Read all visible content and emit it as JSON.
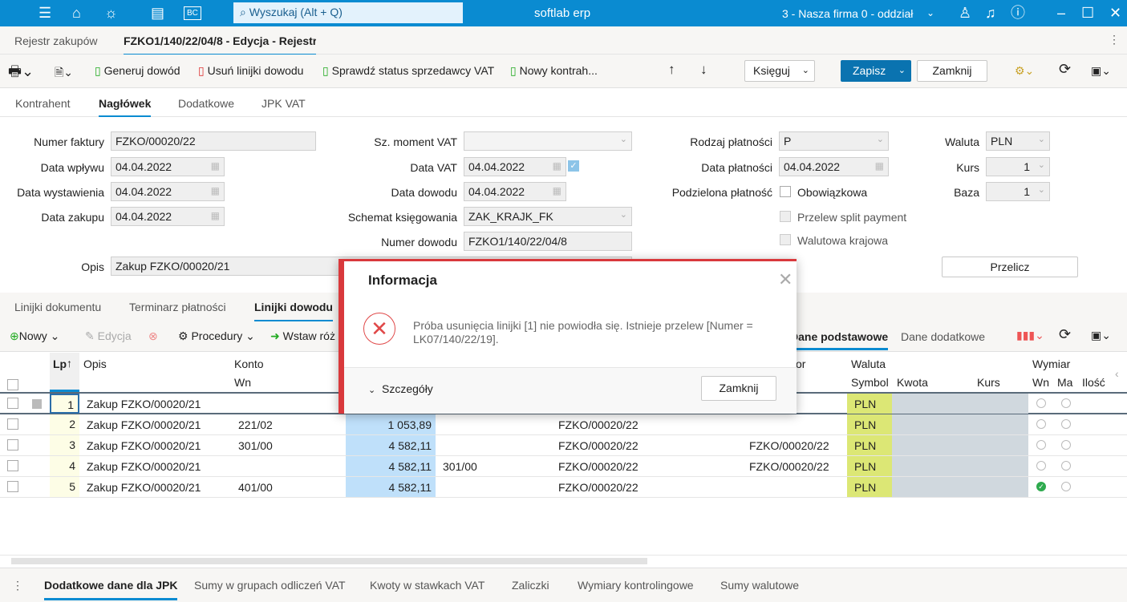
{
  "topbar": {
    "app_title": "softlab erp",
    "search_placeholder": "Wyszukaj (Alt + Q)",
    "company": "3 - Nasza firma 0 - oddział",
    "bc_label": "BC"
  },
  "tabs": [
    {
      "label": "Rejestr zakupów"
    },
    {
      "label": "FZKO1/140/22/04/8 - Edycja - Rejestr"
    }
  ],
  "toolbar": {
    "generate": "Generuj dowód",
    "delete_lines": "Usuń linijki dowodu",
    "check_vat": "Sprawdź status sprzedawcy VAT",
    "new_contractor": "Nowy kontrah...",
    "post": "Księguj",
    "save": "Zapisz",
    "close": "Zamknij"
  },
  "subtabs": [
    "Kontrahent",
    "Nagłówek",
    "Dodatkowe",
    "JPK VAT"
  ],
  "form": {
    "numer_faktury": {
      "label": "Numer faktury",
      "value": "FZKO/00020/22"
    },
    "data_wplywu": {
      "label": "Data wpływu",
      "value": "04.04.2022"
    },
    "data_wystawienia": {
      "label": "Data wystawienia",
      "value": "04.04.2022"
    },
    "data_zakupu": {
      "label": "Data zakupu",
      "value": "04.04.2022"
    },
    "opis": {
      "label": "Opis",
      "value": "Zakup FZKO/00020/21"
    },
    "sz_moment_vat": {
      "label": "Sz. moment VAT",
      "value": ""
    },
    "data_vat": {
      "label": "Data VAT",
      "value": "04.04.2022"
    },
    "data_dowodu": {
      "label": "Data dowodu",
      "value": "04.04.2022"
    },
    "schemat": {
      "label": "Schemat księgowania",
      "value": "ZAK_KRAJK_FK"
    },
    "numer_dowodu": {
      "label": "Numer dowodu",
      "value": "FZKO1/140/22/04/8"
    },
    "rodzaj_platnosci": {
      "label": "Rodzaj płatności",
      "value": "P"
    },
    "data_platnosci": {
      "label": "Data płatności",
      "value": "04.04.2022"
    },
    "podzielona": {
      "label": "Podzielona płatność",
      "option": "Obowiązkowa"
    },
    "split": "Przelew split payment",
    "walutowa": "Walutowa krajowa",
    "waluta": {
      "label": "Waluta",
      "value": "PLN"
    },
    "kurs": {
      "label": "Kurs",
      "value": "1"
    },
    "baza": {
      "label": "Baza",
      "value": "1"
    },
    "przelicz": "Przelicz"
  },
  "lower_tabs": [
    "Linijki dokumentu",
    "Terminarz płatności",
    "Linijki dowodu"
  ],
  "grid_toolbar": {
    "new": "Nowy",
    "edit": "Edycja",
    "procedures": "Procedury",
    "insert": "Wstaw róż",
    "basic": "Dane podstawowe",
    "extra": "Dane dodatkowe"
  },
  "grid": {
    "headers": {
      "lp": "Lp",
      "opis": "Opis",
      "konto": "Konto",
      "wn": "Wn",
      "or": "or",
      "waluta": "Waluta",
      "symbol": "Symbol",
      "kwota": "Kwota",
      "kurs": "Kurs",
      "wymiar": "Wymiar",
      "wwn": "Wn",
      "wma": "Ma",
      "ilosc": "Ilość"
    },
    "rows": [
      {
        "lp": "1",
        "opis": "Zakup FZKO/00020/21",
        "wn": "",
        "amount": "",
        "ma": "",
        "doc": "",
        "doc2": "",
        "symbol": "PLN",
        "wn_checked": false
      },
      {
        "lp": "2",
        "opis": "Zakup FZKO/00020/21",
        "wn": "221/02",
        "amount": "1 053,89",
        "ma": "",
        "doc": "FZKO/00020/22",
        "doc2": "",
        "symbol": "PLN",
        "wn_checked": false
      },
      {
        "lp": "3",
        "opis": "Zakup FZKO/00020/21",
        "wn": "301/00",
        "amount": "4 582,11",
        "ma": "",
        "doc": "FZKO/00020/22",
        "doc2": "FZKO/00020/22",
        "symbol": "PLN",
        "wn_checked": false
      },
      {
        "lp": "4",
        "opis": "Zakup FZKO/00020/21",
        "wn": "",
        "amount": "4 582,11",
        "ma": "301/00",
        "doc": "FZKO/00020/22",
        "doc2": "FZKO/00020/22",
        "symbol": "PLN",
        "wn_checked": false
      },
      {
        "lp": "5",
        "opis": "Zakup FZKO/00020/21",
        "wn": "401/00",
        "amount": "4 582,11",
        "ma": "",
        "doc": "FZKO/00020/22",
        "doc2": "",
        "symbol": "PLN",
        "wn_checked": true
      }
    ]
  },
  "bottom_tabs": [
    "Dodatkowe dane dla JPK",
    "Sumy w grupach odliczeń VAT",
    "Kwoty w stawkach VAT",
    "Zaliczki",
    "Wymiary kontrolingowe",
    "Sumy walutowe"
  ],
  "dialog": {
    "title": "Informacja",
    "message": "Próba usunięcia linijki [1] nie powiodła się. Istnieje przelew [Numer = LK07/140/22/19].",
    "details": "Szczegóły",
    "close": "Zamknij"
  },
  "colors": {
    "brand": "#0a8bd1",
    "primary_button": "#0a73b0",
    "error": "#d9393c",
    "amount_cell": "#bfe0fa",
    "symbol_cell": "#dce775",
    "kwota_cell": "#d0d8de"
  }
}
